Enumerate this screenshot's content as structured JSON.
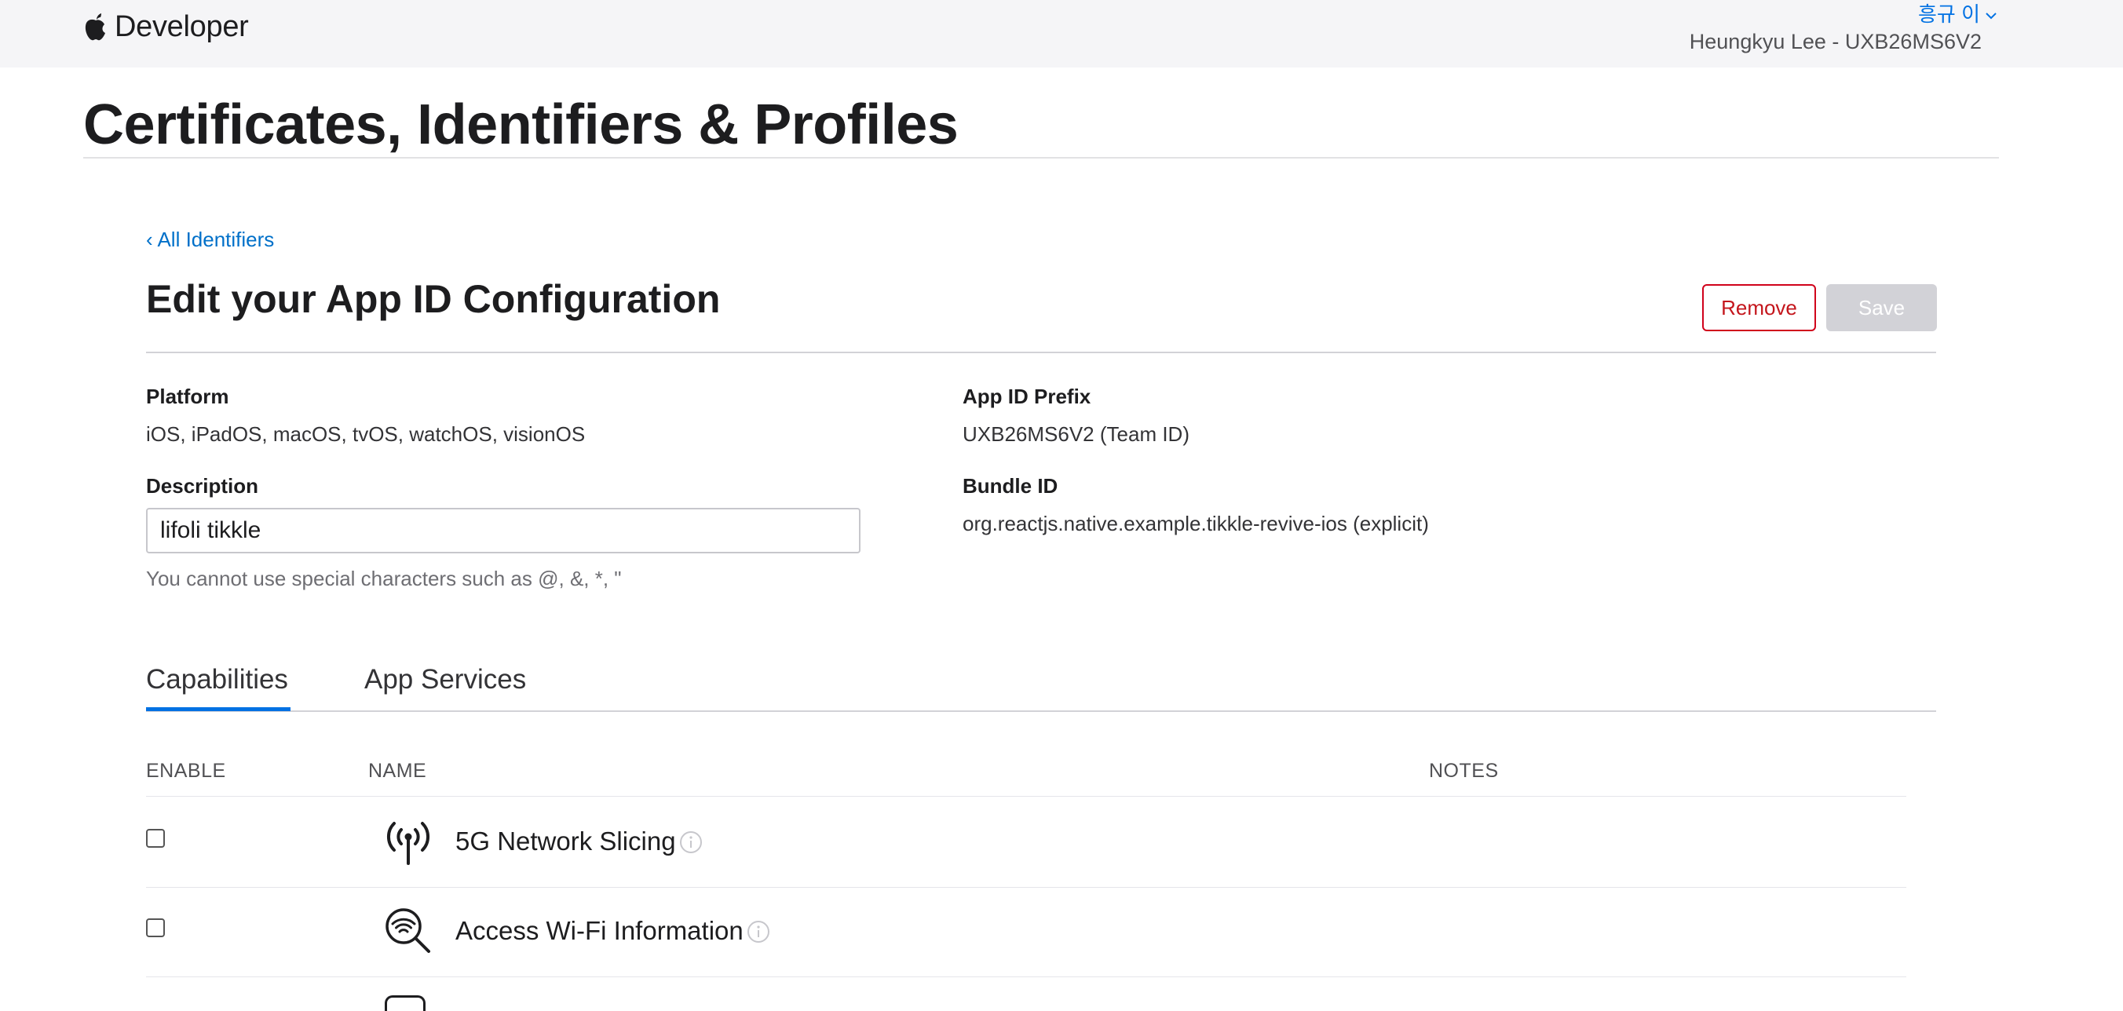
{
  "header": {
    "brand": "Developer",
    "user_name": "흥규 이",
    "account": "Heungkyu Lee - UXB26MS6V2"
  },
  "page_title": "Certificates, Identifiers & Profiles",
  "back_link": "‹ All Identifiers",
  "section": {
    "title": "Edit your App ID Configuration",
    "remove_label": "Remove",
    "save_label": "Save"
  },
  "fields": {
    "platform_label": "Platform",
    "platform_value": "iOS, iPadOS, macOS, tvOS, watchOS, visionOS",
    "prefix_label": "App ID Prefix",
    "prefix_value": "UXB26MS6V2 (Team ID)",
    "description_label": "Description",
    "description_value": "lifoli tikkle",
    "description_hint": "You cannot use special characters such as @, &, *, \"",
    "bundle_label": "Bundle ID",
    "bundle_value": "org.reactjs.native.example.tikkle-revive-ios (explicit)"
  },
  "tabs": [
    {
      "label": "Capabilities",
      "active": true
    },
    {
      "label": "App Services",
      "active": false
    }
  ],
  "table": {
    "headers": {
      "enable": "ENABLE",
      "name": "NAME",
      "notes": "NOTES"
    },
    "rows": [
      {
        "name": "5G Network Slicing",
        "icon": "antenna-icon",
        "enabled": false
      },
      {
        "name": "Access Wi-Fi Information",
        "icon": "wifi-search-icon",
        "enabled": false
      }
    ]
  },
  "colors": {
    "accent": "#0071e3",
    "link": "#0070c9",
    "danger": "#c4161c",
    "disabled": "#d2d2d7",
    "topbar_bg": "#f5f5f7"
  }
}
